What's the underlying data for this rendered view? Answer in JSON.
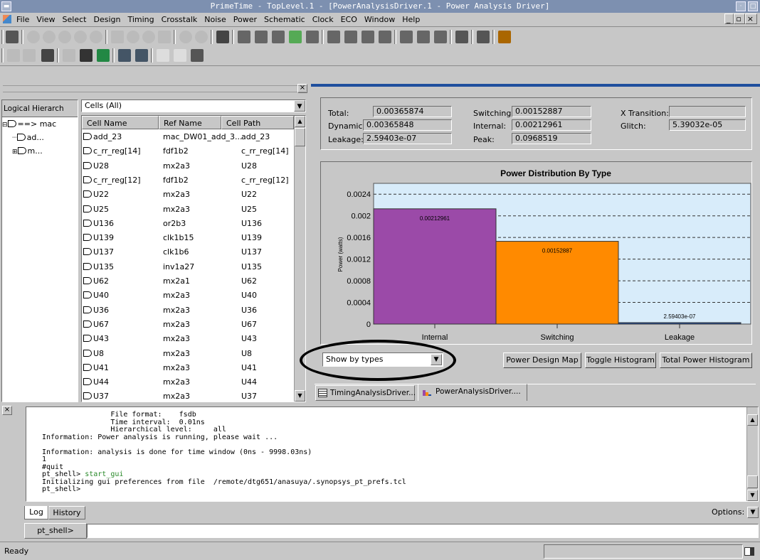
{
  "window": {
    "title": "PrimeTime - TopLevel.1 - [PowerAnalysisDriver.1 - Power Analysis Driver]"
  },
  "menus": [
    "File",
    "View",
    "Select",
    "Design",
    "Timing",
    "Crosstalk",
    "Noise",
    "Power",
    "Schematic",
    "Clock",
    "ECO",
    "Window",
    "Help"
  ],
  "hierarchy": {
    "header": "Logical Hierarch",
    "items": [
      "==> mac",
      "ad...",
      "m..."
    ]
  },
  "cells": {
    "filter": "Cells (All)",
    "columns": [
      "Cell Name",
      "Ref Name",
      "Cell Path"
    ],
    "rows": [
      [
        "add_23",
        "mac_DW01_add_3...",
        "add_23"
      ],
      [
        "c_rr_reg[14]",
        "fdf1b2",
        "c_rr_reg[14]"
      ],
      [
        "U28",
        "mx2a3",
        "U28"
      ],
      [
        "c_rr_reg[12]",
        "fdf1b2",
        "c_rr_reg[12]"
      ],
      [
        "U22",
        "mx2a3",
        "U22"
      ],
      [
        "U25",
        "mx2a3",
        "U25"
      ],
      [
        "U136",
        "or2b3",
        "U136"
      ],
      [
        "U139",
        "clk1b15",
        "U139"
      ],
      [
        "U137",
        "clk1b6",
        "U137"
      ],
      [
        "U135",
        "inv1a27",
        "U135"
      ],
      [
        "U62",
        "mx2a1",
        "U62"
      ],
      [
        "U40",
        "mx2a3",
        "U40"
      ],
      [
        "U36",
        "mx2a3",
        "U36"
      ],
      [
        "U67",
        "mx2a3",
        "U67"
      ],
      [
        "U43",
        "mx2a3",
        "U43"
      ],
      [
        "U8",
        "mx2a3",
        "U8"
      ],
      [
        "U41",
        "mx2a3",
        "U41"
      ],
      [
        "U44",
        "mx2a3",
        "U44"
      ],
      [
        "U37",
        "mx2a3",
        "U37"
      ]
    ]
  },
  "summary": {
    "total_label": "Total:",
    "total": "0.00365874",
    "dynamic_label": "Dynamic:",
    "dynamic": "0.00365848",
    "leakage_label": "Leakage:",
    "leakage": "2.59403e-07",
    "switching_label": "Switching:",
    "switching": "0.00152887",
    "internal_label": "Internal:",
    "internal": "0.00212961",
    "peak_label": "Peak:",
    "peak": "0.0968519",
    "xtrans_label": "X Transition:",
    "xtrans": "",
    "glitch_label": "Glitch:",
    "glitch": "5.39032e-05"
  },
  "chart_data": {
    "type": "bar",
    "title": "Power Distribution By Type",
    "ylabel": "Power (watts)",
    "categories": [
      "Internal",
      "Switching",
      "Leakage"
    ],
    "values": [
      0.00212961,
      0.00152887,
      2.59403e-07
    ],
    "data_labels": [
      "0.00212961",
      "0.00152887",
      "2.59403e-07"
    ],
    "ylim": [
      0,
      0.0026
    ],
    "yticks": [
      "0",
      "0.0004",
      "0.0008",
      "0.0012",
      "0.0016",
      "0.002",
      "0.0024"
    ],
    "ytick_values": [
      0,
      0.0004,
      0.0008,
      0.0012,
      0.0016,
      0.002,
      0.0024
    ],
    "colors": [
      "#9b4aa8",
      "#ff8a00",
      "#1f4e9e"
    ],
    "grid": true
  },
  "controls": {
    "show_select": "Show by types",
    "power_design_map": "Power Design Map",
    "toggle_histogram": "Toggle Histogram",
    "total_power_histogram": "Total Power Histogram"
  },
  "tabs": [
    "TimingAnalysisDriver...",
    "PowerAnalysisDriver...."
  ],
  "console": {
    "lines": [
      "                File format:    fsdb",
      "                Time interval:  0.01ns",
      "                Hierarchical level:     all",
      "Information: Power analysis is running, please wait ...",
      "",
      "Information: analysis is done for time window (0ns - 9998.03ns)",
      "1",
      "#quit",
      "pt_shell> start_gui",
      "Initializing gui preferences from file  /remote/dtg651/anasuya/.synopsys_pt_prefs.tcl",
      "pt_shell>"
    ],
    "tab_log": "Log",
    "tab_history": "History",
    "options": "Options:",
    "prompt": "pt_shell>",
    "input": ""
  },
  "status": {
    "text": "Ready"
  }
}
